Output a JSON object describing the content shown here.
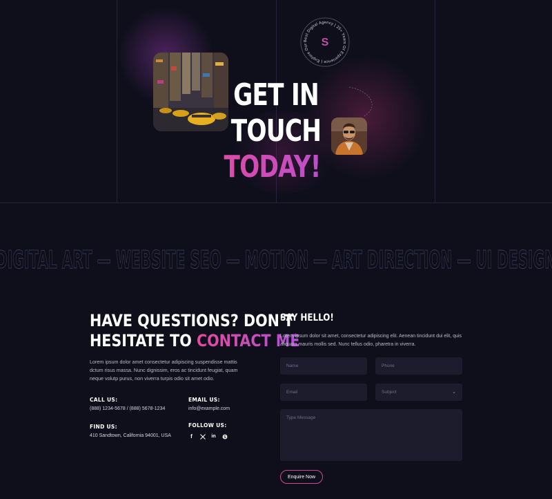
{
  "hero": {
    "title_line1": "GET IN TOUCH",
    "title_line2": "TODAY!",
    "badge_letter": "S",
    "badge_ring_text": "Best Digital Agency | 25+ Years Of Experience | Explore Our Works |"
  },
  "marquee": {
    "text": "DIGITAL ART — WEBSITE SEO — MOTION — ART DIRECTION — UI DESIGN"
  },
  "contact": {
    "title_line1": "HAVE QUESTIONS? DON'T",
    "title_line2_plain": "HESITATE TO ",
    "title_line2_accent": "CONTACT ME",
    "body": "Lorem ipsum dolor amet consectetur adipiscing suspendisse mattis dctum risus massa. Nunc dignissim, eros ac tincidunt feugiat, quam neque volutp purus, non viverra turpis odio sit amet odio.",
    "call_label": "CALL US:",
    "call_value": "(888) 1234-5678 / (888) 5678-1234",
    "email_label": "EMAIL US:",
    "email_value": "info@example.com",
    "find_label": "FIND US:",
    "find_value": "410 Sandtown, California 94001, USA",
    "follow_label": "FOLLOW US:",
    "social_icons": [
      "facebook-icon",
      "x-icon",
      "linkedin-icon",
      "skype-icon"
    ]
  },
  "form": {
    "title": "SAY HELLO!",
    "body": "Lorem ipsum dolor sit amet, consectetur adipiscing elit. Aenean tincidunt dui elit, quis aliquam mauris mollis sed. Nunc tellus odio, pharetra in viverra.",
    "name_placeholder": "Name",
    "phone_placeholder": "Phone",
    "email_placeholder": "Email",
    "subject_placeholder": "Subject",
    "message_placeholder": "Type Message",
    "submit_label": "Enquire Now"
  },
  "colors": {
    "background": "#0f0f1c",
    "accent_pink": "#e64a9c",
    "accent_purple": "#b050d8",
    "field_bg": "#1c1c2c"
  }
}
